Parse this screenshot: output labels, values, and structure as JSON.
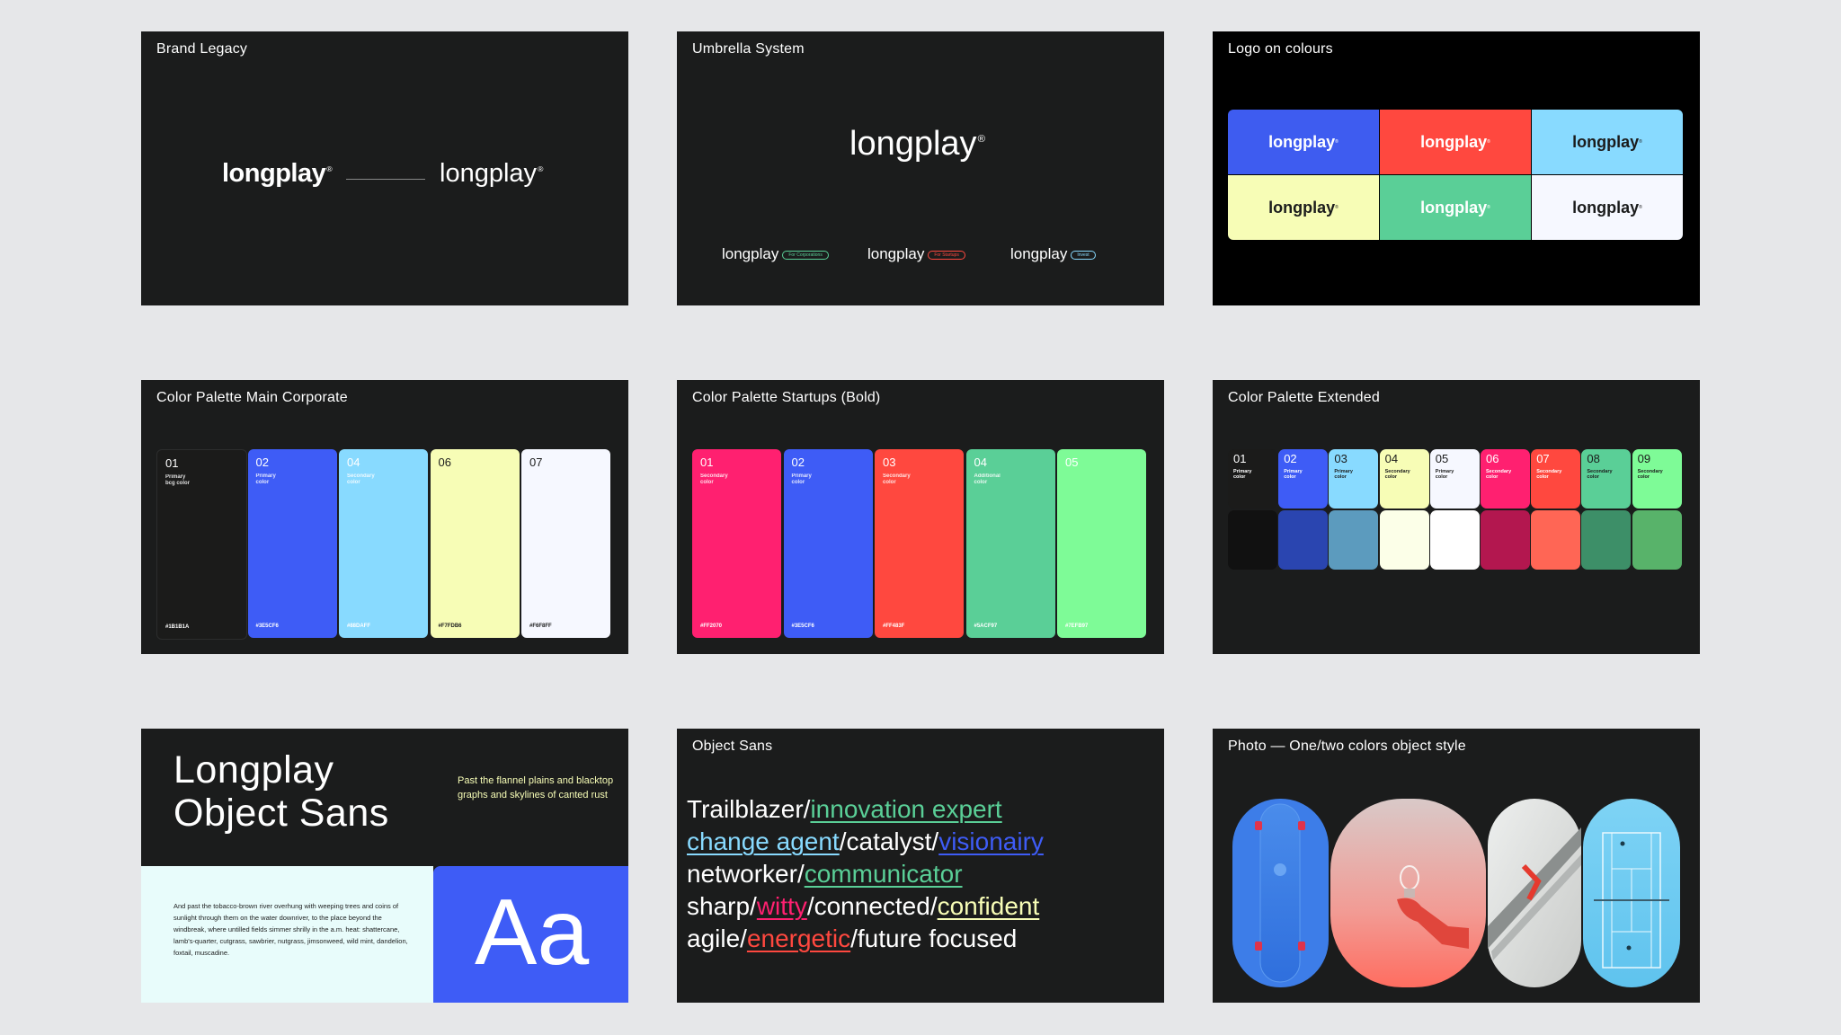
{
  "cards": {
    "brand_legacy": {
      "title": "Brand Legacy",
      "logo_old": "longplay",
      "logo_new": "longplay"
    },
    "umbrella": {
      "title": "Umbrella System",
      "logo_main": "longplay",
      "subs": [
        {
          "logo": "longplay",
          "tag": "For Corporations",
          "color": "#5ACF97"
        },
        {
          "logo": "longplay",
          "tag": "For Startups",
          "color": "#FF483F"
        },
        {
          "logo": "longplay",
          "tag": "Invest",
          "color": "#88DAFF"
        }
      ]
    },
    "logo_on_colours": {
      "title": "Logo on colours",
      "tiles": [
        {
          "text": "longplay",
          "bg": "#3E5CF0",
          "fg": "#FFFFFF"
        },
        {
          "text": "longplay",
          "bg": "#FF483F",
          "fg": "#FFFFFF"
        },
        {
          "text": "longplay",
          "bg": "#88DAFF",
          "fg": "#1B1C1C"
        },
        {
          "text": "longplay",
          "bg": "#F7FDB6",
          "fg": "#1B1C1C"
        },
        {
          "text": "longplay",
          "bg": "#5ACF97",
          "fg": "#FFFFFF"
        },
        {
          "text": "longplay",
          "bg": "#F6F8FF",
          "fg": "#1B1C1C"
        }
      ]
    },
    "palette_main": {
      "title": "Color Palette Main Corporate",
      "swatches": [
        {
          "num": "01",
          "label": "Primary\nbcg color",
          "hex": "#1B1B1A",
          "bg": "#1B1B1A",
          "fg": "#FFFFFF"
        },
        {
          "num": "02",
          "label": "Primary\ncolor",
          "hex": "#3E5CF6",
          "bg": "#3E5CF6",
          "fg": "#FFFFFF"
        },
        {
          "num": "04",
          "label": "Secondary\ncolor",
          "hex": "#88DAFF",
          "bg": "#88DAFF",
          "fg": "#FFFFFF"
        },
        {
          "num": "06",
          "label": "",
          "hex": "#F7FDB6",
          "bg": "#F7FDB6",
          "fg": "#1B1C1C"
        },
        {
          "num": "07",
          "label": "",
          "hex": "#F6F8FF",
          "bg": "#F6F8FF",
          "fg": "#1B1C1C"
        }
      ]
    },
    "palette_startups": {
      "title": "Color Palette Startups (Bold)",
      "swatches": [
        {
          "num": "01",
          "label": "Secondary\ncolor",
          "hex": "#FF2070",
          "bg": "#FF2070",
          "fg": "#FFFFFF"
        },
        {
          "num": "02",
          "label": "Primary\ncolor",
          "hex": "#3E5CF6",
          "bg": "#3E5CF6",
          "fg": "#FFFFFF"
        },
        {
          "num": "03",
          "label": "Secondary\ncolor",
          "hex": "#FF483F",
          "bg": "#FF483F",
          "fg": "#FFFFFF"
        },
        {
          "num": "04",
          "label": "Additional\ncolor",
          "hex": "#5ACF97",
          "bg": "#5ACF97",
          "fg": "#FFFFFF"
        },
        {
          "num": "05",
          "label": "",
          "hex": "#7EFB97",
          "bg": "#7EFB97",
          "fg": "#FFFFFF"
        }
      ]
    },
    "palette_extended": {
      "title": "Color Palette Extended",
      "swatches": [
        {
          "num": "01",
          "label": "Primary\ncolor",
          "top": "#1B1B1A",
          "bottom": "#111111",
          "fg": "#FFFFFF"
        },
        {
          "num": "02",
          "label": "Primary\ncolor",
          "top": "#3E5CF6",
          "bottom": "#2A45B0",
          "fg": "#FFFFFF"
        },
        {
          "num": "03",
          "label": "Primary\ncolor",
          "top": "#88DAFF",
          "bottom": "#5C9BBE",
          "fg": "#1B1C1C"
        },
        {
          "num": "04",
          "label": "Secondary\ncolor",
          "top": "#F7FDB6",
          "bottom": "#FCFFE8",
          "fg": "#1B1C1C"
        },
        {
          "num": "05",
          "label": "Primary\ncolor",
          "top": "#F6F8FF",
          "bottom": "#FFFFFF",
          "fg": "#1B1C1C"
        },
        {
          "num": "06",
          "label": "Secondary\ncolor",
          "top": "#FF2070",
          "bottom": "#B3174F",
          "fg": "#FFFFFF"
        },
        {
          "num": "07",
          "label": "Secondary\ncolor",
          "top": "#FF483F",
          "bottom": "#FF6655",
          "fg": "#FFFFFF"
        },
        {
          "num": "08",
          "label": "Secondary\ncolor",
          "top": "#5ACF97",
          "bottom": "#3D8F68",
          "fg": "#1B1C1C"
        },
        {
          "num": "09",
          "label": "Secondary\ncolor",
          "top": "#7EFB97",
          "bottom": "#58B36A",
          "fg": "#1B1C1C"
        }
      ]
    },
    "typeface": {
      "title_line1": "Longplay",
      "title_line2": "Object Sans",
      "side_note": "Past the flannel plains and blacktop graphs and skylines of canted rust",
      "body": "And past the tobacco-brown river overhung with weeping trees and coins of sunlight through them on the water downriver, to the place beyond the windbreak, where untilled fields simmer shrilly in the a.m. heat: shattercane, lamb's-quarter, cutgrass, sawbrier, nutgrass, jimsonweed, wild mint, dandelion, foxtail, muscadine.",
      "sample": "Aa"
    },
    "object_sans": {
      "title": "Object Sans",
      "lines": [
        [
          {
            "t": "Trailblazer/"
          },
          {
            "t": "innovation expert",
            "c": "#5ACF97"
          }
        ],
        [
          {
            "t": "change agent",
            "c": "#88DAFF"
          },
          {
            "t": "/catalyst/"
          },
          {
            "t": "visionairy",
            "c": "#3E5CF6"
          }
        ],
        [
          {
            "t": "networker/"
          },
          {
            "t": "communicator",
            "c": "#5ACF97"
          }
        ],
        [
          {
            "t": "sharp/"
          },
          {
            "t": "witty",
            "c": "#FF2070"
          },
          {
            "t": "/connected/"
          },
          {
            "t": "confident",
            "c": "#F7FDB6"
          }
        ],
        [
          {
            "t": "agile/"
          },
          {
            "t": "energetic",
            "c": "#FF483F"
          },
          {
            "t": "/future focused"
          }
        ]
      ]
    },
    "photo": {
      "title": "Photo — One/two colors object style"
    }
  }
}
